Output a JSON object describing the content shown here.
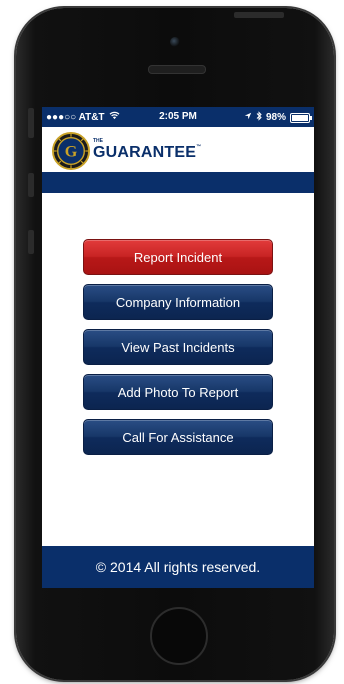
{
  "status_bar": {
    "carrier": "●●●○○ AT&T",
    "time": "2:05 PM",
    "battery": "98%",
    "battery_level": 0.98
  },
  "header": {
    "brand_small": "THE",
    "brand": "GUARANTEE",
    "brand_tm": "™",
    "logo_letter": "G"
  },
  "menu": {
    "items": [
      {
        "label": "Report Incident"
      },
      {
        "label": "Company Information"
      },
      {
        "label": "View Past Incidents"
      },
      {
        "label": "Add Photo To Report"
      },
      {
        "label": "Call For Assistance"
      }
    ]
  },
  "footer": {
    "text": "© 2014 All rights reserved."
  },
  "colors": {
    "brand_blue": "#0a2f6a",
    "primary_red": "#c82424",
    "gold": "#c9a227"
  }
}
